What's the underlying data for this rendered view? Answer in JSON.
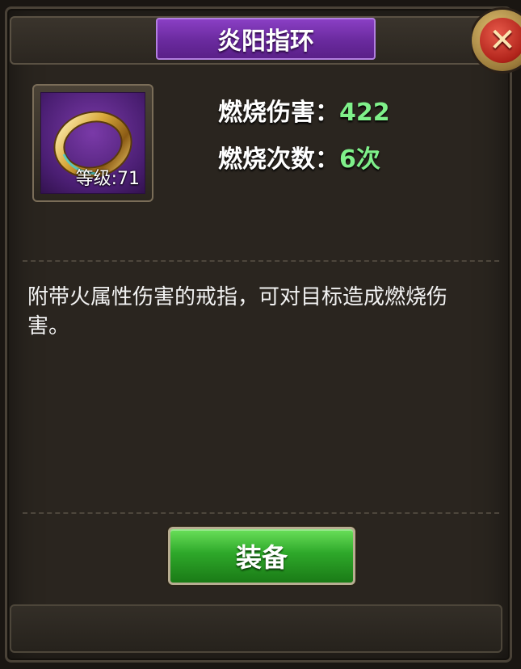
{
  "title": "炎阳指环",
  "close_icon": "close-x-icon",
  "item": {
    "icon": "gold-ring-icon",
    "level_label": "等级:71"
  },
  "stats": [
    {
      "label": "燃烧伤害：",
      "value": "422"
    },
    {
      "label": "燃烧次数：",
      "value": "6次"
    }
  ],
  "description": "附带火属性伤害的戒指，可对目标造成燃烧伤害。",
  "equip_button": "装备",
  "colors": {
    "title_plate": "#7a34b4",
    "stat_value": "#7ff08a",
    "equip_button": "#2ea82a",
    "close_button": "#b0231a"
  }
}
